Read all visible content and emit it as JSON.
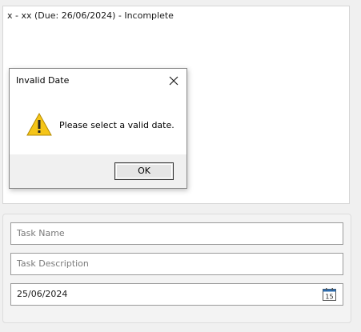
{
  "tasks": [
    {
      "text": "x - xx (Due: 26/06/2024) - Incomplete"
    }
  ],
  "form": {
    "task_name_placeholder": "Task Name",
    "task_description_placeholder": "Task Description",
    "due_date_value": "25/06/2024",
    "calendar_icon": "calendar-icon",
    "calendar_day": "15"
  },
  "dialog": {
    "title": "Invalid Date",
    "message": "Please select a valid date.",
    "ok_label": "OK",
    "icon": "warning-icon"
  },
  "colors": {
    "warning_yellow": "#f5c518",
    "calendar_blue": "#2b6cb0"
  }
}
